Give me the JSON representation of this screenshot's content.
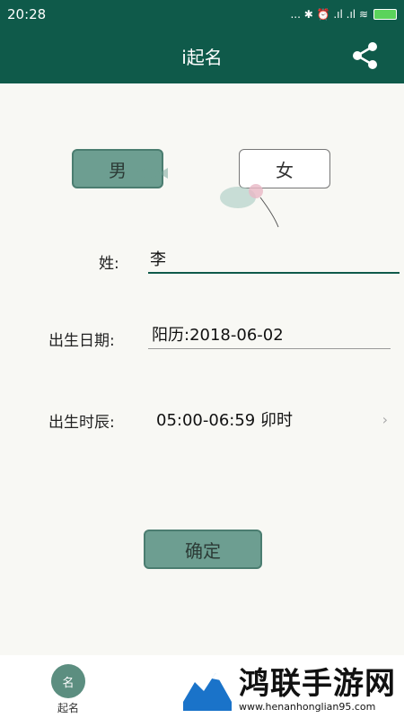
{
  "status_bar": {
    "time": "20:28",
    "indicators": "... ✱ ⏰ .ıl .ıl ≋"
  },
  "app_bar": {
    "title": "i起名",
    "share_icon": "share-icon"
  },
  "gender": {
    "male_label": "男",
    "female_label": "女",
    "selected": "male"
  },
  "form": {
    "surname_label": "姓:",
    "surname_value": "李",
    "birth_label": "出生日期:",
    "birth_value": "阳历:2018-06-02",
    "hour_label": "出生时辰:",
    "hour_value": "05:00-06:59 卯时",
    "chevron": "›"
  },
  "confirm_label": "确定",
  "bottom_tab": {
    "label": "起名",
    "icon_text": "名"
  },
  "watermark": {
    "title": "鸿联手游网",
    "url": "www.henanhonglian95.com"
  },
  "colors": {
    "primary": "#0f5a4a",
    "button": "#6d9e91"
  }
}
